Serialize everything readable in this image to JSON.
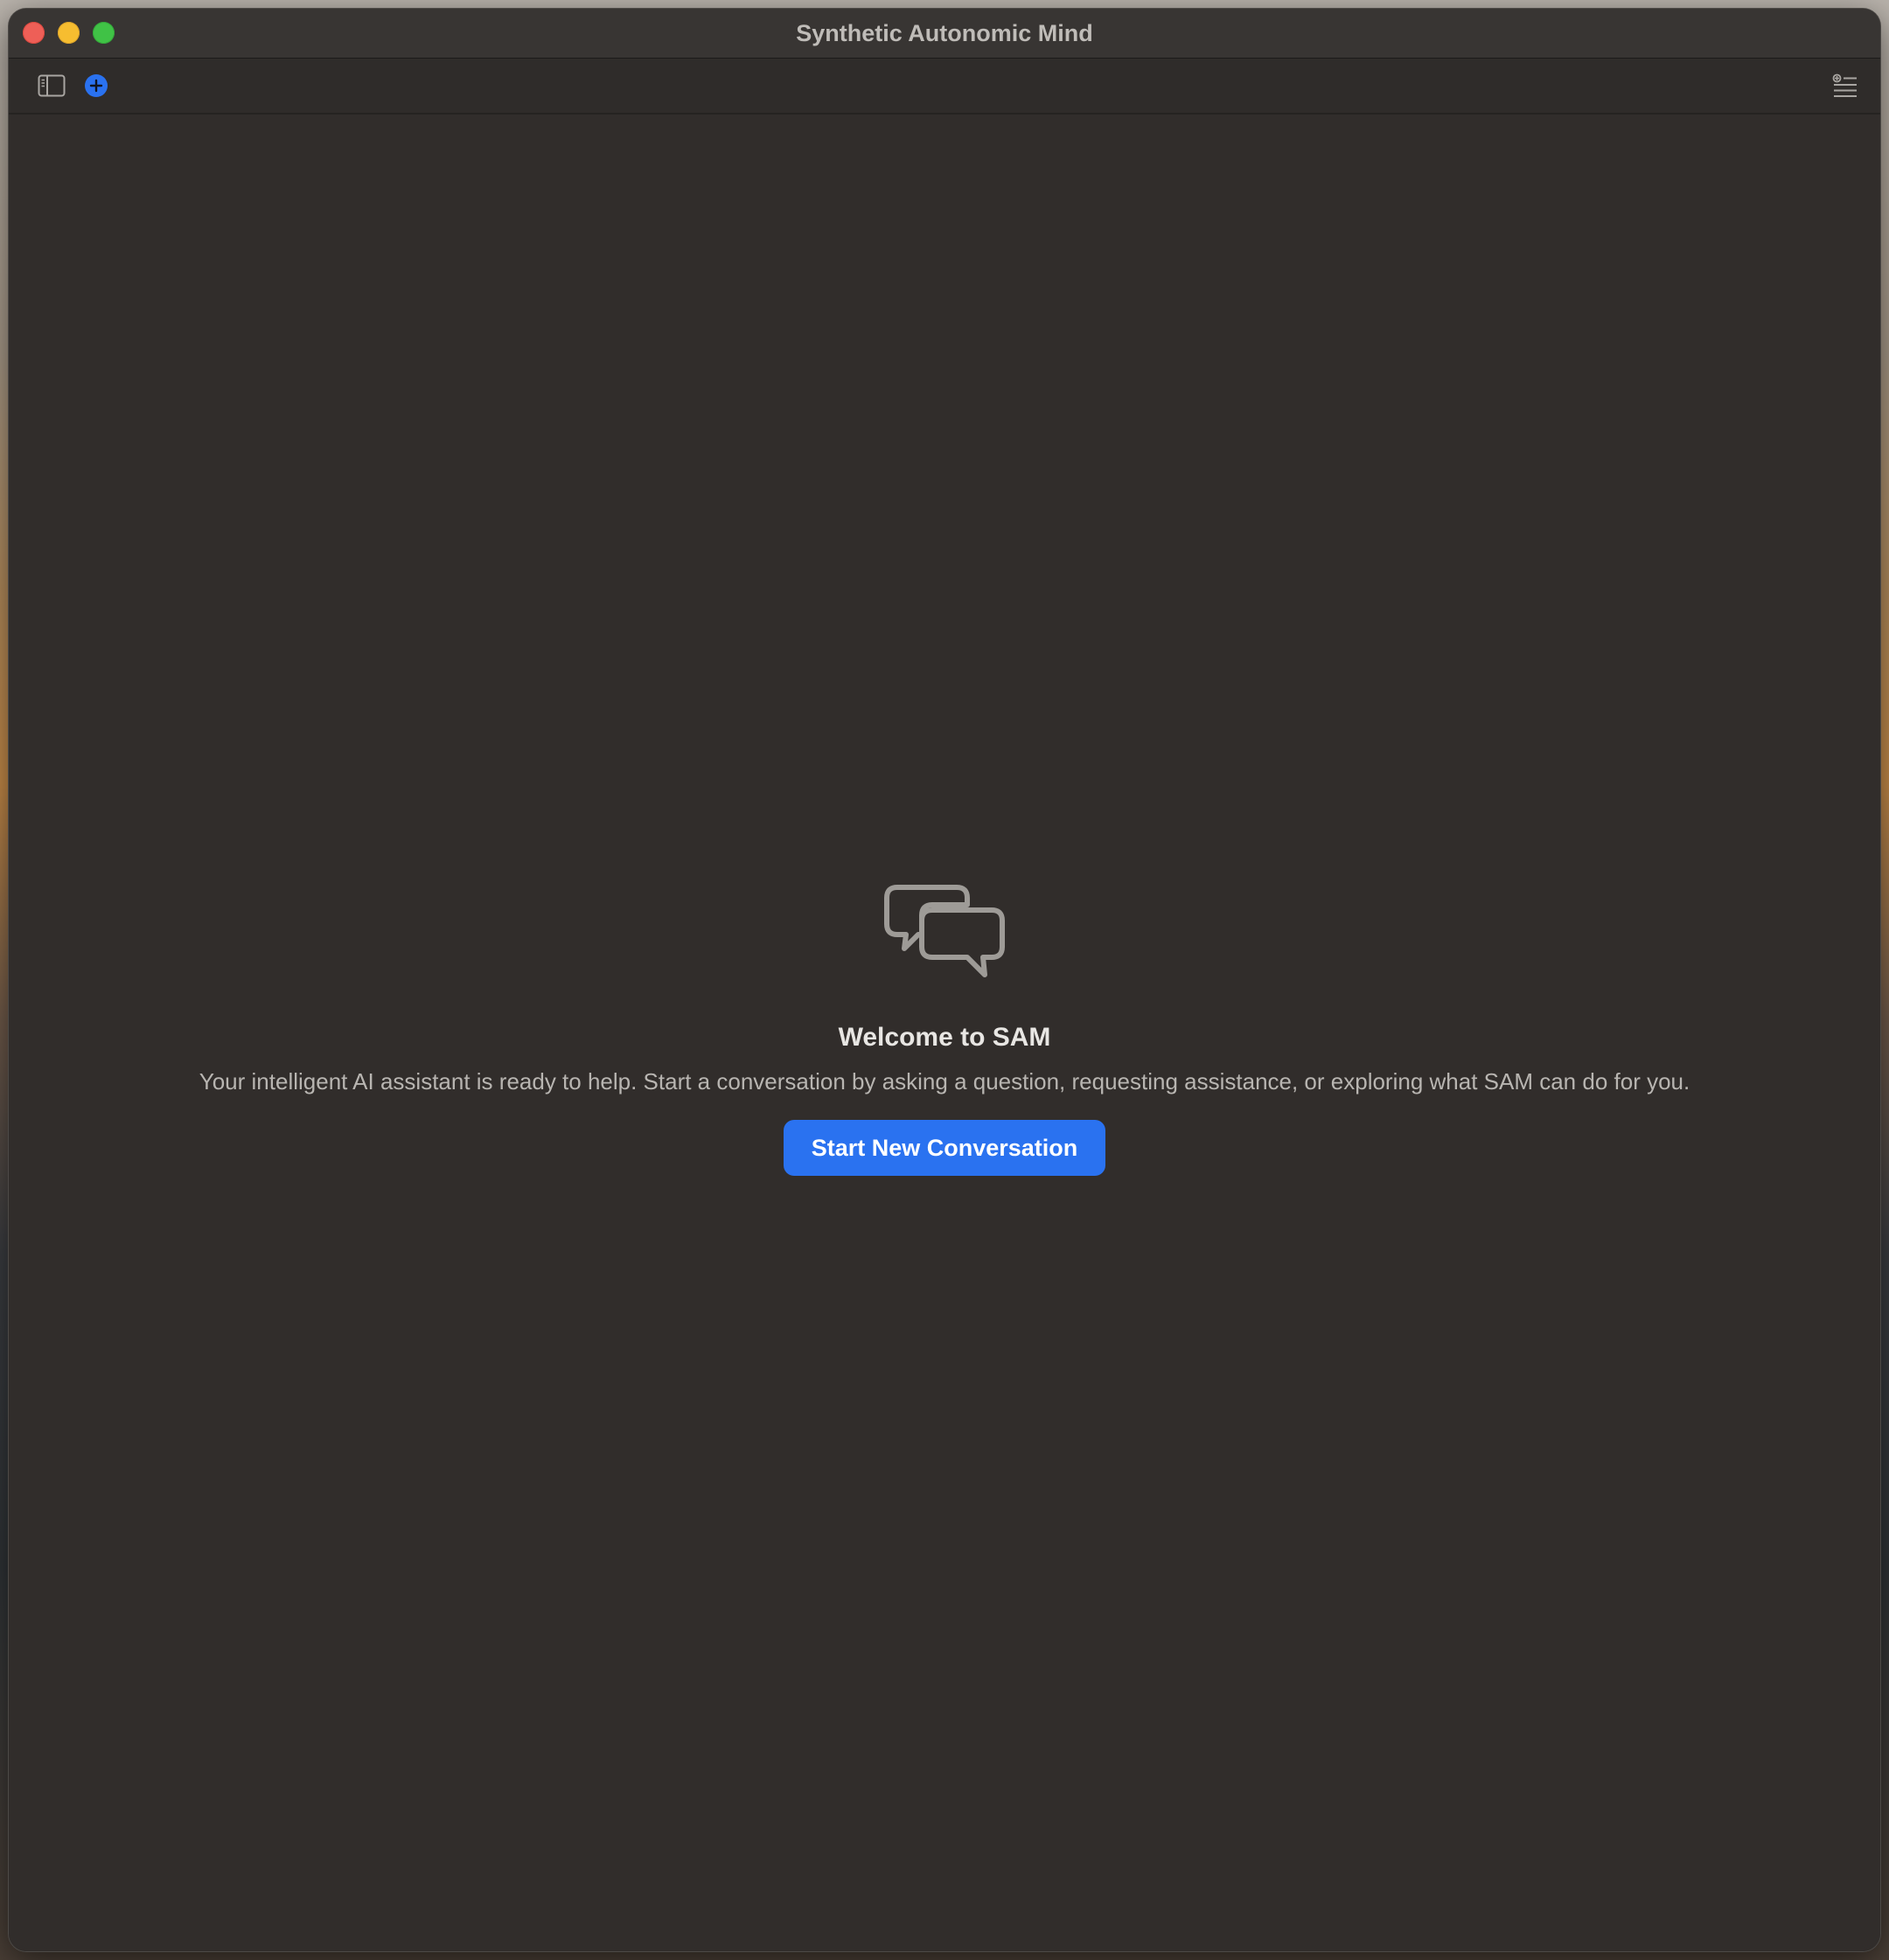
{
  "window": {
    "title": "Synthetic Autonomic Mind"
  },
  "toolbar": {
    "left_icons": [
      "sidebar-toggle-icon",
      "plus-circle-icon"
    ],
    "right_icons": [
      "inspector-list-icon"
    ],
    "accent_color": "#2a72f0"
  },
  "welcome": {
    "icon": "chat-bubbles-icon",
    "title": "Welcome to SAM",
    "description": "Your intelligent AI assistant is ready to help. Start a conversation by asking a question, requesting assistance, or exploring what SAM can do for you.",
    "button_label": "Start New Conversation"
  },
  "colors": {
    "window_background": "#312d2b",
    "titlebar_background": "#383533",
    "close": "#ee5f57",
    "minimize": "#f6bd30",
    "zoom": "#40c246",
    "button_background": "#2a72f0"
  }
}
